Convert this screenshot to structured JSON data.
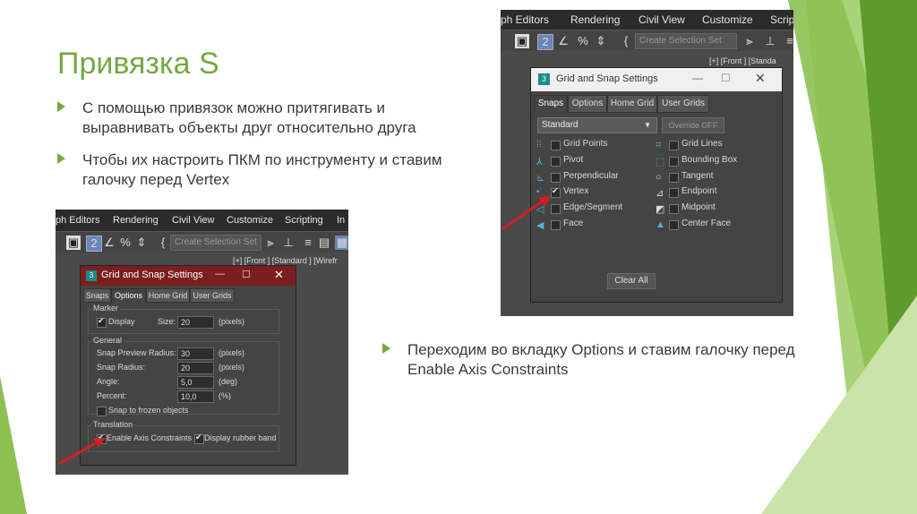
{
  "slide": {
    "title": "Привязка S",
    "bullets": [
      "С помощью привязок можно притягивать и выравнивать объекты друг относительно друга",
      "Чтобы их настроить ПКМ по инструменту и ставим галочку перед Vertex",
      "Переходим во вкладку Options и ставим галочку перед Enable Axis Constraints"
    ],
    "accent": "#76a844"
  },
  "shot1": {
    "menu": [
      "ph Editors",
      "Rendering",
      "Civil View",
      "Customize",
      "Scripti"
    ],
    "toolbar_select": "Create Selection Set",
    "viewport_label": "[+] [Front ] [Standa",
    "dialog": {
      "title": "Grid and Snap Settings",
      "tabs": [
        "Snaps",
        "Options",
        "Home Grid",
        "User Grids"
      ],
      "active_tab": "Snaps",
      "dropdown": "Standard",
      "override": "Override OFF",
      "left": [
        {
          "label": "Grid Points",
          "icon": "grid-points-icon",
          "checked": false
        },
        {
          "label": "Pivot",
          "icon": "pivot-icon",
          "checked": false
        },
        {
          "label": "Perpendicular",
          "icon": "perpendicular-icon",
          "checked": false
        },
        {
          "label": "Vertex",
          "icon": "vertex-icon",
          "checked": true
        },
        {
          "label": "Edge/Segment",
          "icon": "edge-icon",
          "checked": false
        },
        {
          "label": "Face",
          "icon": "face-icon",
          "checked": false
        }
      ],
      "right": [
        {
          "label": "Grid Lines",
          "icon": "grid-lines-icon",
          "checked": false
        },
        {
          "label": "Bounding Box",
          "icon": "bounding-box-icon",
          "checked": false
        },
        {
          "label": "Tangent",
          "icon": "tangent-icon",
          "checked": false
        },
        {
          "label": "Endpoint",
          "icon": "endpoint-icon",
          "checked": false
        },
        {
          "label": "Midpoint",
          "icon": "midpoint-icon",
          "checked": false
        },
        {
          "label": "Center Face",
          "icon": "center-face-icon",
          "checked": false
        }
      ],
      "clear_all": "Clear All"
    }
  },
  "shot2": {
    "menu": [
      "ph Editors",
      "Rendering",
      "Civil View",
      "Customize",
      "Scripting",
      "In"
    ],
    "toolbar_select": "Create Selection Set",
    "viewport_label": "[+] [Front ] [Standard ] [Wirefr",
    "dialog": {
      "title": "Grid and Snap Settings",
      "tabs": [
        "Snaps",
        "Options",
        "Home Grid",
        "User Grids"
      ],
      "active_tab": "Options",
      "marker_group": "Marker",
      "display_label": "Display",
      "size_label": "Size:",
      "size_value": "20",
      "size_unit": "(pixels)",
      "general_group": "General",
      "general": [
        {
          "label": "Snap Preview Radius:",
          "value": "30",
          "unit": "(pixels)"
        },
        {
          "label": "Snap Radius:",
          "value": "20",
          "unit": "(pixels)"
        },
        {
          "label": "Angle:",
          "value": "5,0",
          "unit": "(deg)"
        },
        {
          "label": "Percent:",
          "value": "10,0",
          "unit": "(%)"
        }
      ],
      "snap_frozen": "Snap to frozen objects",
      "translation_group": "Translation",
      "enable_axis": "Enable Axis Constraints",
      "rubber_band": "Display rubber band"
    }
  }
}
